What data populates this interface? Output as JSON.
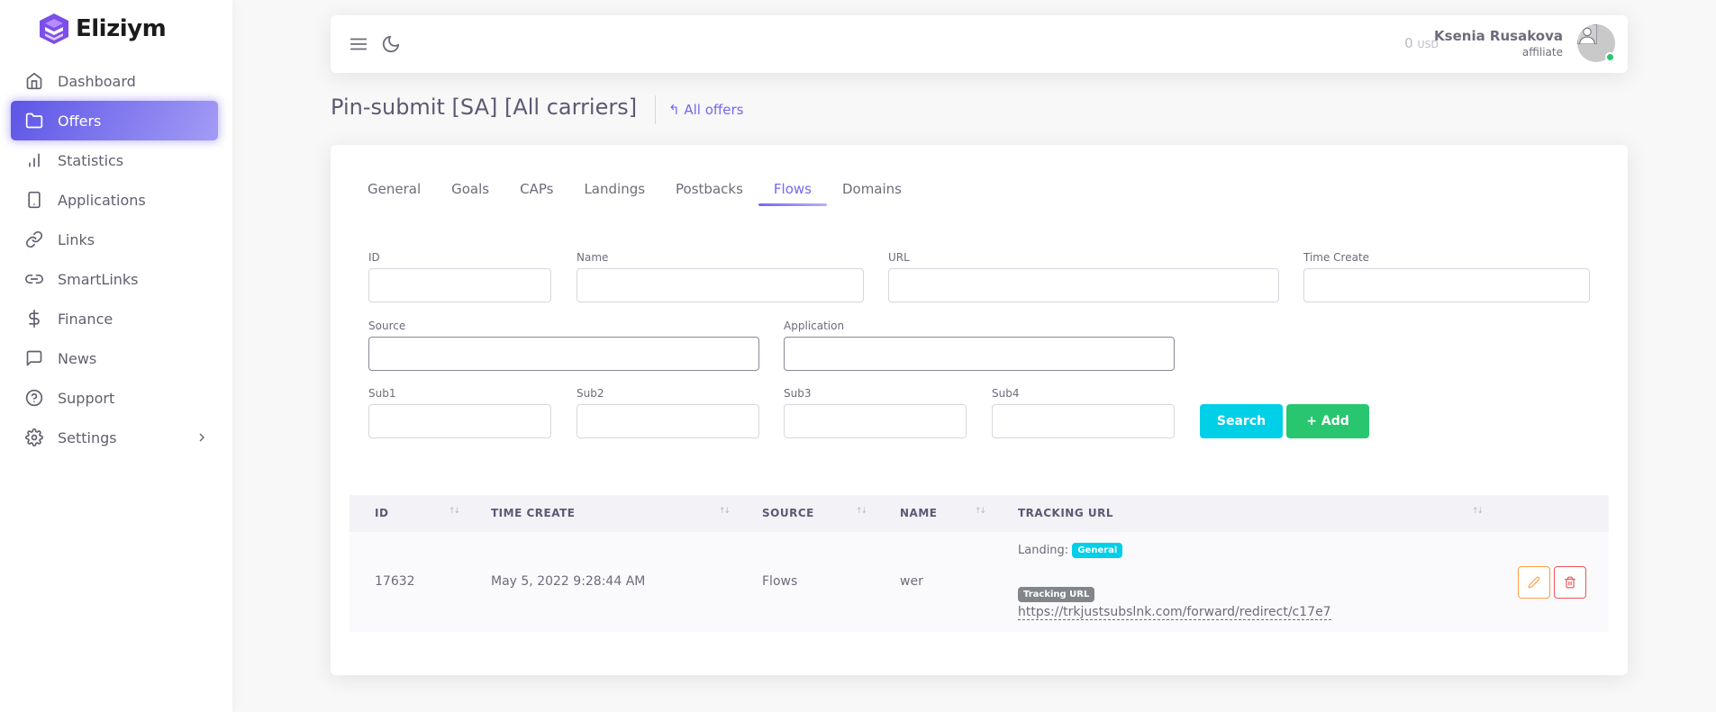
{
  "brand": {
    "name": "Eliziym"
  },
  "sidebar": {
    "items": [
      {
        "label": "Dashboard",
        "icon": "home-icon"
      },
      {
        "label": "Offers",
        "icon": "folder-icon",
        "active": true
      },
      {
        "label": "Statistics",
        "icon": "bar-chart-icon"
      },
      {
        "label": "Applications",
        "icon": "smartphone-icon"
      },
      {
        "label": "Links",
        "icon": "link-icon"
      },
      {
        "label": "SmartLinks",
        "icon": "link-2-icon"
      },
      {
        "label": "Finance",
        "icon": "dollar-sign-icon"
      },
      {
        "label": "News",
        "icon": "message-square-icon"
      },
      {
        "label": "Support",
        "icon": "help-circle-icon"
      },
      {
        "label": "Settings",
        "icon": "settings-icon"
      }
    ]
  },
  "navbar": {
    "balance_amount": "0",
    "balance_currency": "USD",
    "user_name": "Ksenia Rusakova",
    "user_role": "affiliate"
  },
  "page": {
    "title": "Pin-submit [SA] [All carriers]",
    "back_link": "All offers"
  },
  "tabs": [
    "General",
    "Goals",
    "CAPs",
    "Landings",
    "Postbacks",
    "Flows",
    "Domains"
  ],
  "active_tab": "Flows",
  "filters": {
    "id_label": "ID",
    "name_label": "Name",
    "url_label": "URL",
    "time_create_label": "Time Create",
    "source_label": "Source",
    "application_label": "Application",
    "sub1_label": "Sub1",
    "sub2_label": "Sub2",
    "sub3_label": "Sub3",
    "sub4_label": "Sub4",
    "search_button": "Search",
    "add_button": "+ Add"
  },
  "table": {
    "headers": {
      "id": "ID",
      "time_create": "TIME CREATE",
      "source": "SOURCE",
      "name": "NAME",
      "tracking_url": "TRACKING URL"
    },
    "rows": [
      {
        "id": "17632",
        "time_create": "May 5, 2022 9:28:44 AM",
        "source": "Flows",
        "name": "wer",
        "landing_label": "Landing:",
        "landing_badge": "General",
        "tracking_badge": "Tracking URL",
        "tracking_url": "https://trkjustsubslnk.com/forward/redirect/c17e7"
      }
    ]
  },
  "colors": {
    "primary": "#7367f0",
    "info": "#00cfe8",
    "success": "#28c76f",
    "warning": "#ff9f43",
    "danger": "#ea5455"
  }
}
